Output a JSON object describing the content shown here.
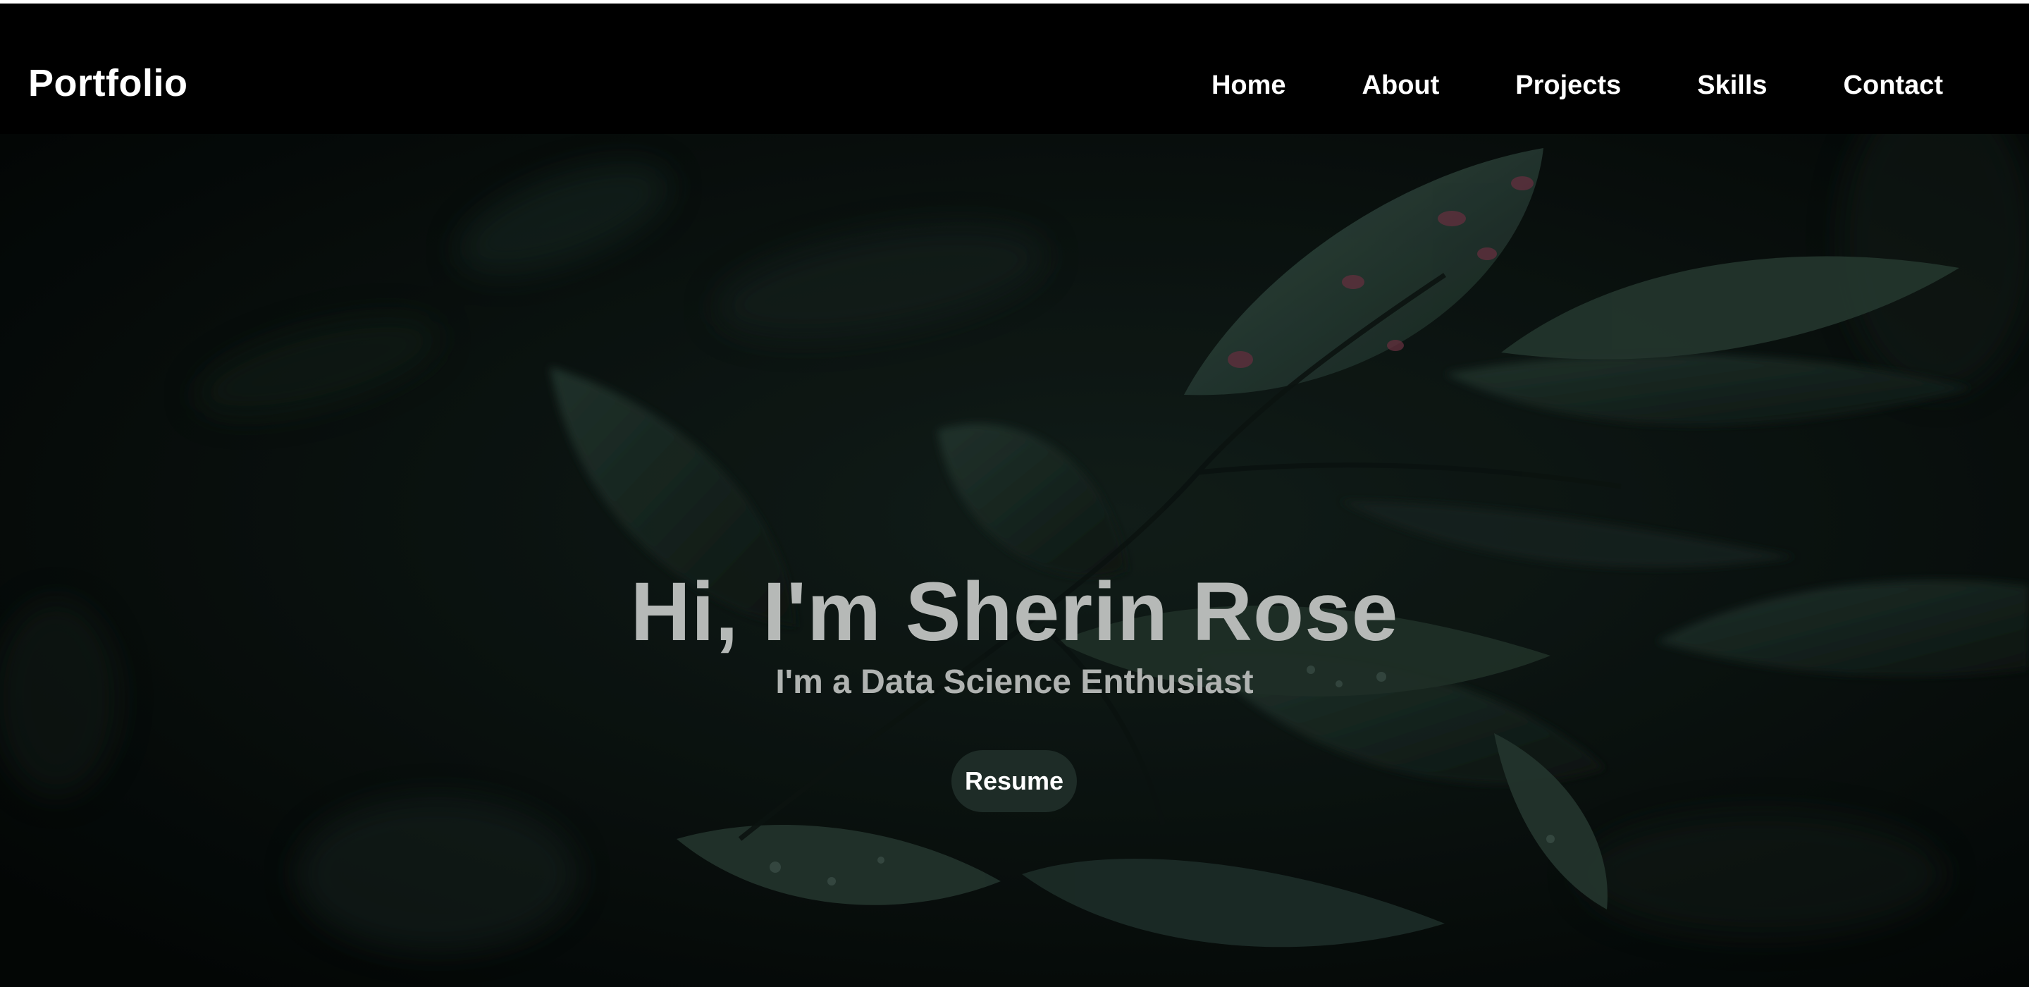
{
  "nav": {
    "brand": "Portfolio",
    "links": [
      "Home",
      "About",
      "Projects",
      "Skills",
      "Contact"
    ]
  },
  "hero": {
    "title": "Hi, I'm Sherin Rose",
    "subtitle": "I'm a Data Science Enthusiast",
    "button_label": "Resume",
    "background_description_icon": "leaf-photo-background"
  },
  "colors": {
    "navbar_bg": "#000000",
    "hero_bg": "#050b09",
    "leaf_tint": "#2f4a40",
    "title_text": "#b6b9b7",
    "button_bg": "#1e2c27",
    "link_text": "#ffffff"
  }
}
